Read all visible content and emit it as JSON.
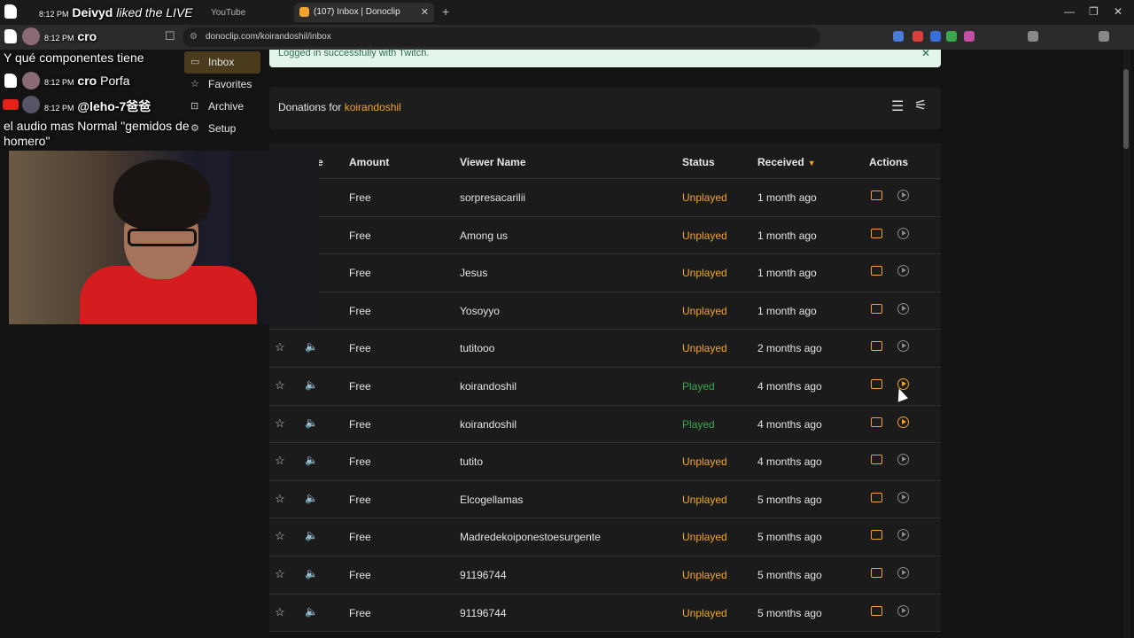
{
  "browser": {
    "tabs": [
      {
        "label": "YouTube",
        "active": false
      },
      {
        "label": "(107) Inbox | Donoclip",
        "active": true
      }
    ],
    "url": "donoclip.com/koirandoshil/inbox"
  },
  "sidebar": {
    "items": [
      {
        "label": "Inbox",
        "icon": "inbox-icon"
      },
      {
        "label": "Favorites",
        "icon": "star-icon"
      },
      {
        "label": "Archive",
        "icon": "archive-icon"
      },
      {
        "label": "Setup",
        "icon": "setup-icon"
      }
    ]
  },
  "banner": {
    "text": "Logged in successfully with Twitch."
  },
  "panel": {
    "title_prefix": "Donations for",
    "username": "koirandoshil"
  },
  "table": {
    "headers": {
      "type": "e",
      "amount": "Amount",
      "viewer": "Viewer Name",
      "status": "Status",
      "received": "Received",
      "actions": "Actions"
    },
    "rows": [
      {
        "amount": "Free",
        "viewer": "sorpresacarilii",
        "status": "Unplayed",
        "received": "1 month ago"
      },
      {
        "amount": "Free",
        "viewer": "Among us",
        "status": "Unplayed",
        "received": "1 month ago"
      },
      {
        "amount": "Free",
        "viewer": "Jesus",
        "status": "Unplayed",
        "received": "1 month ago"
      },
      {
        "amount": "Free",
        "viewer": "Yosoyyo",
        "status": "Unplayed",
        "received": "1 month ago"
      },
      {
        "amount": "Free",
        "viewer": "tutitooo",
        "status": "Unplayed",
        "received": "2 months ago"
      },
      {
        "amount": "Free",
        "viewer": "koirandoshil",
        "status": "Played",
        "received": "4 months ago"
      },
      {
        "amount": "Free",
        "viewer": "koirandoshil",
        "status": "Played",
        "received": "4 months ago"
      },
      {
        "amount": "Free",
        "viewer": "tutito",
        "status": "Unplayed",
        "received": "4 months ago"
      },
      {
        "amount": "Free",
        "viewer": "Elcogellamas",
        "status": "Unplayed",
        "received": "5 months ago"
      },
      {
        "amount": "Free",
        "viewer": "Madredekoiponestoesurgente",
        "status": "Unplayed",
        "received": "5 months ago"
      },
      {
        "amount": "Free",
        "viewer": "91196744",
        "status": "Unplayed",
        "received": "5 months ago"
      },
      {
        "amount": "Free",
        "viewer": "91196744",
        "status": "Unplayed",
        "received": "5 months ago"
      }
    ]
  },
  "chat": {
    "lines": [
      {
        "time": "8:12 PM",
        "name": "Deivyd",
        "text": "liked the LIVE"
      },
      {
        "time": "8:12 PM",
        "name": "cro",
        "text": ""
      },
      {
        "text": "Y qué componentes tiene"
      },
      {
        "time": "8:12 PM",
        "name": "cro",
        "text": "Porfa"
      },
      {
        "time": "8:12 PM",
        "name": "@leho-7爸爸",
        "text": ""
      },
      {
        "text": "el audio mas Normal \"gemidos de homero\""
      }
    ]
  },
  "colors": {
    "accent": "#f3a42b",
    "played": "#38a94b",
    "background": "#131313"
  }
}
